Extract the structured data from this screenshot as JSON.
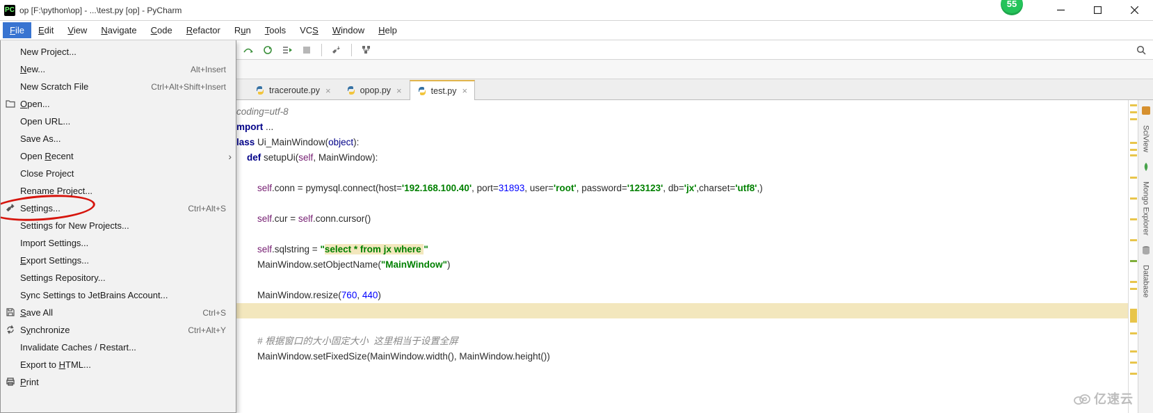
{
  "title": "op [F:\\python\\op] - ...\\test.py [op] - PyCharm",
  "badge_value": "55",
  "menu": {
    "items": [
      {
        "letter": "F",
        "rest": "ile",
        "active": true
      },
      {
        "letter": "E",
        "rest": "dit"
      },
      {
        "letter": "V",
        "rest": "iew"
      },
      {
        "letter": "N",
        "rest": "avigate"
      },
      {
        "letter": "C",
        "rest": "ode"
      },
      {
        "letter": "R",
        "rest": "efactor"
      },
      {
        "pre": "R",
        "letter": "u",
        "rest": "n"
      },
      {
        "letter": "T",
        "rest": "ools"
      },
      {
        "pre": "VC",
        "letter": "S",
        "rest": ""
      },
      {
        "letter": "W",
        "rest": "indow"
      },
      {
        "letter": "H",
        "rest": "elp"
      }
    ]
  },
  "dropdown": {
    "items": [
      {
        "label": "New Project...",
        "shortcut": ""
      },
      {
        "u": "N",
        "rest": "ew...",
        "shortcut": "Alt+Insert"
      },
      {
        "label": "New Scratch File",
        "shortcut": "Ctrl+Alt+Shift+Insert"
      },
      {
        "u": "O",
        "rest": "pen...",
        "icon": "folder",
        "shortcut": ""
      },
      {
        "label": "Open URL...",
        "shortcut": ""
      },
      {
        "label": "Save As...",
        "shortcut": ""
      },
      {
        "pre": "Open ",
        "u": "R",
        "rest": "ecent",
        "sub": true,
        "shortcut": ""
      },
      {
        "label": "Close Project",
        "shortcut": ""
      },
      {
        "label": "Rename Project...",
        "shortcut": ""
      },
      {
        "pre": "Se",
        "u": "t",
        "rest": "tings...",
        "icon": "wrench",
        "shortcut": "Ctrl+Alt+S",
        "circled": true
      },
      {
        "label": "Settings for New Projects...",
        "shortcut": ""
      },
      {
        "label": "Import Settings...",
        "shortcut": ""
      },
      {
        "u": "E",
        "rest": "xport Settings...",
        "shortcut": ""
      },
      {
        "label": "Settings Repository...",
        "shortcut": ""
      },
      {
        "label": "Sync Settings to JetBrains Account...",
        "shortcut": ""
      },
      {
        "u": "S",
        "rest": "ave All",
        "icon": "save",
        "shortcut": "Ctrl+S"
      },
      {
        "pre": "S",
        "u": "y",
        "rest": "nchronize",
        "icon": "sync",
        "shortcut": "Ctrl+Alt+Y"
      },
      {
        "label": "Invalidate Caches / Restart...",
        "shortcut": ""
      },
      {
        "pre": "Export to ",
        "u": "H",
        "rest": "TML...",
        "shortcut": ""
      },
      {
        "u": "P",
        "rest": "rint",
        "icon": "print",
        "shortcut": ""
      }
    ]
  },
  "tabs": [
    {
      "name": "traceroute.py",
      "active": false
    },
    {
      "name": "opop.py",
      "active": false
    },
    {
      "name": "test.py",
      "active": true
    }
  ],
  "side_tabs": {
    "sciview": "SciView",
    "mongo": "Mongo Explorer",
    "database": "Database"
  },
  "code": {
    "l1": "coding=utf-8",
    "l2a": "mport",
    "l2b": " ...",
    "l3a": "lass",
    "l3b": " Ui_MainWindow(",
    "l3c": "object",
    "l3d": "):",
    "l4a": "    def ",
    "l4b": "setupUi",
    "l4c": "(",
    "l4d": "self",
    "l4e": ", MainWindow):",
    "l6a": "        ",
    "l6b": "self",
    "l6c": ".conn = pymysql.connect(host=",
    "l6d": "'192.168.100.40'",
    "l6e": ", port=",
    "l6f": "31893",
    "l6g": ", user=",
    "l6h": "'root'",
    "l6i": ", password=",
    "l6j": "'123123'",
    "l6k": ", db=",
    "l6l": "'jx'",
    "l6m": ",charset=",
    "l6n": "'utf8'",
    "l6o": ",)",
    "l8a": "        ",
    "l8b": "self",
    "l8c": ".cur = ",
    "l8d": "self",
    "l8e": ".conn.cursor()",
    "l10a": "        ",
    "l10b": "self",
    "l10c": ".sqlstring = ",
    "l10d": "\"",
    "l10e": "select * from jx where ",
    "l10f": "\"",
    "l11a": "        MainWindow.setObjectName(",
    "l11b": "\"MainWindow\"",
    "l11c": ")",
    "l13a": "        MainWindow.resize(",
    "l13b": "760",
    "l13c": ", ",
    "l13d": "440",
    "l13e": ")",
    "l16a": "        ",
    "l16b": "# 根据窗口的大小固定大小  这里相当于设置全屏",
    "l17": "        MainWindow.setFixedSize(MainWindow.width(), MainWindow.height())"
  },
  "watermark": "亿速云"
}
